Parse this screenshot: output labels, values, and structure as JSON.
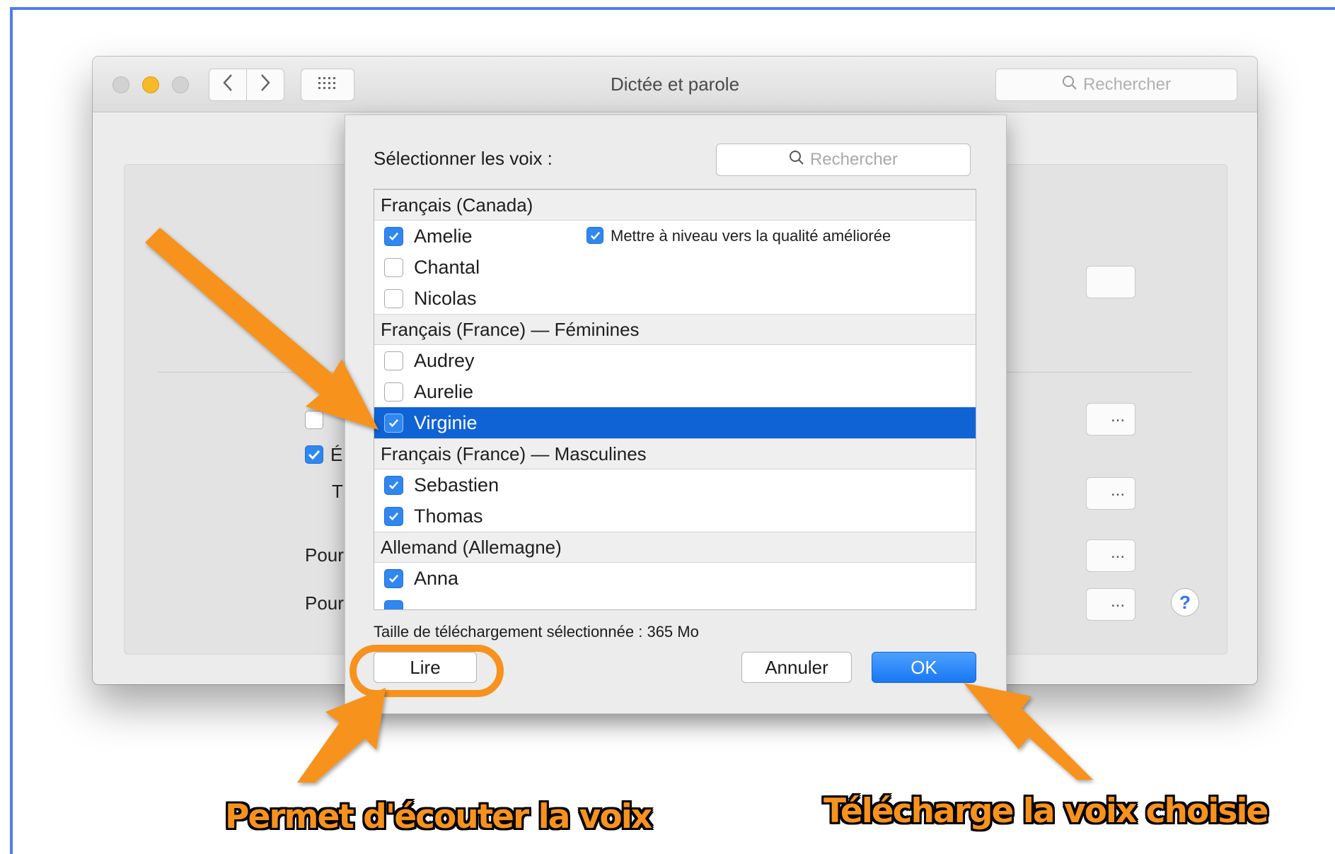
{
  "window": {
    "title": "Dictée et parole",
    "search_placeholder": "Rechercher",
    "nav_back_icon": "chevron-left-icon",
    "nav_forward_icon": "chevron-right-icon",
    "grid_icon": "grid-icon"
  },
  "background": {
    "checkbox_label_partial": "É",
    "text_partial_1": "T",
    "text_partial_2": "Pour",
    "text_partial_3": "Pour",
    "ellipsis": "...",
    "help_label": "?"
  },
  "sheet": {
    "label": "Sélectionner les voix :",
    "search_placeholder": "Rechercher",
    "groups": [
      {
        "title": "Français (Canada)",
        "voices": [
          {
            "name": "Amelie",
            "checked": true
          },
          {
            "name": "Chantal",
            "checked": false
          },
          {
            "name": "Nicolas",
            "checked": false
          }
        ]
      },
      {
        "title": "Français (France) — Féminines",
        "voices": [
          {
            "name": "Audrey",
            "checked": false
          },
          {
            "name": "Aurelie",
            "checked": false
          },
          {
            "name": "Virginie",
            "checked": true,
            "selected": true
          }
        ]
      },
      {
        "title": "Français (France) — Masculines",
        "voices": [
          {
            "name": "Sebastien",
            "checked": true
          },
          {
            "name": "Thomas",
            "checked": true
          }
        ]
      },
      {
        "title": "Allemand (Allemagne)",
        "voices": [
          {
            "name": "Anna",
            "checked": true
          }
        ]
      }
    ],
    "upgrade_label": "Mettre à niveau vers la qualité améliorée",
    "upgrade_checked": true,
    "download_size": "Taille de téléchargement sélectionnée : 365 Mo",
    "play_button": "Lire",
    "cancel_button": "Annuler",
    "ok_button": "OK"
  },
  "annotations": {
    "callout_left": "Permet d'écouter la voix",
    "callout_right": "Télécharge la voix choisie",
    "accent_color": "#f7921e"
  }
}
